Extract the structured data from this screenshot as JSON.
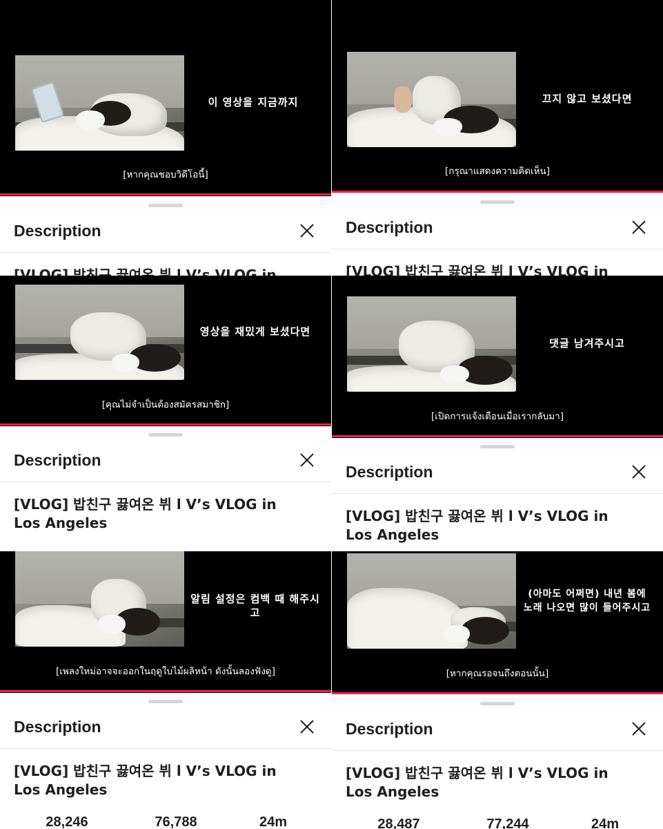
{
  "description_label": "Description",
  "video_title": "[VLOG] 밥친구 끓여온 뷔 l V’s VLOG in Los Angeles",
  "accent_color": "#ff1c4f",
  "panels": [
    {
      "subtitle_ko": "이 영상을 지금까지",
      "subtitle_th": "[หากคุณชอบวิดีโอนี้]"
    },
    {
      "subtitle_ko": "끄지 않고 보셨다면",
      "subtitle_th": "[กรุณาแสดงความคิดเห็น]"
    },
    {
      "subtitle_ko": "영상을 재밌게 보셨다면",
      "subtitle_th": "[คุณไม่จำเป็นต้องสมัครสมาชิก]"
    },
    {
      "subtitle_ko": "댓글 남겨주시고",
      "subtitle_th": "[เปิดการแจ้งเตือนเมื่อเรากลับมา]"
    },
    {
      "subtitle_ko": "알림 설정은 컴백 때 해주시고",
      "subtitle_th": "[เพลงใหม่อาจจะออกในฤดูใบไม้ผลิหน้า ดังนั้นลองฟังดู]",
      "stats": {
        "likes": "28,246",
        "views": "76,788",
        "time": "24m"
      }
    },
    {
      "subtitle_ko": "(아마도 어쩌면) 내년 봄에\n노래 나오면 많이 들어주시고",
      "subtitle_th": "[หากคุณรอจนถึงตอนนั้น]",
      "stats": {
        "likes": "28,487",
        "views": "77,244",
        "time": "24m"
      }
    }
  ]
}
